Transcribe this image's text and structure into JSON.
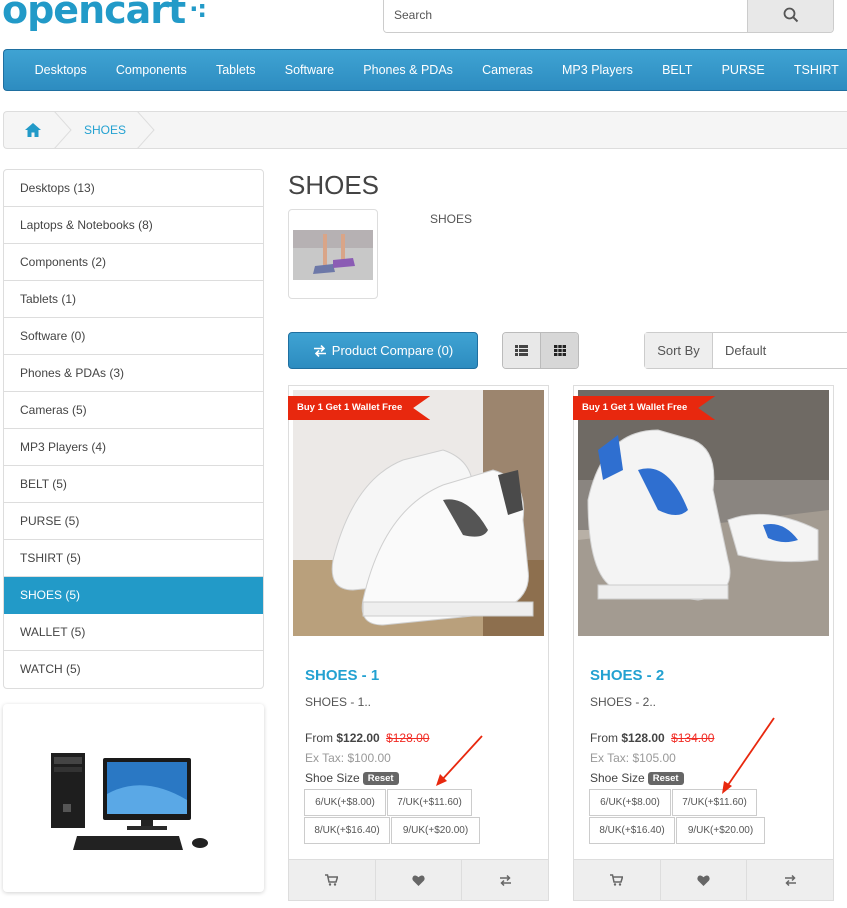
{
  "header": {
    "logo_text": "opencart",
    "search_placeholder": "Search"
  },
  "menu": [
    "Desktops",
    "Components",
    "Tablets",
    "Software",
    "Phones & PDAs",
    "Cameras",
    "MP3 Players",
    "BELT",
    "PURSE",
    "TSHIRT"
  ],
  "breadcrumb": {
    "current": "SHOES"
  },
  "categories": [
    {
      "label": "Desktops (13)",
      "active": false
    },
    {
      "label": "Laptops & Notebooks (8)",
      "active": false
    },
    {
      "label": "Components (2)",
      "active": false
    },
    {
      "label": "Tablets (1)",
      "active": false
    },
    {
      "label": "Software (0)",
      "active": false
    },
    {
      "label": "Phones & PDAs (3)",
      "active": false
    },
    {
      "label": "Cameras (5)",
      "active": false
    },
    {
      "label": "MP3 Players (4)",
      "active": false
    },
    {
      "label": "BELT (5)",
      "active": false
    },
    {
      "label": "PURSE (5)",
      "active": false
    },
    {
      "label": "TSHIRT (5)",
      "active": false
    },
    {
      "label": "SHOES (5)",
      "active": true
    },
    {
      "label": "WALLET (5)",
      "active": false
    },
    {
      "label": "WATCH (5)",
      "active": false
    }
  ],
  "page": {
    "title": "SHOES",
    "description": "SHOES"
  },
  "toolbar": {
    "compare_label": "Product Compare (0)",
    "sort_label": "Sort By",
    "sort_value": "Default"
  },
  "products": [
    {
      "ribbon": "Buy 1 Get 1 Wallet Free",
      "name": "SHOES - 1",
      "desc": "SHOES - 1..",
      "price_prefix": "From",
      "price": "$122.00",
      "old_price": "$128.00",
      "ex_tax": "Ex Tax: $100.00",
      "size_label": "Shoe Size",
      "reset_label": "Reset",
      "options": [
        "6/UK(+$8.00)",
        "7/UK(+$11.60)",
        "8/UK(+$16.40)",
        "9/UK(+$20.00)"
      ],
      "accent": "#4a4a4a"
    },
    {
      "ribbon": "Buy 1 Get 1 Wallet Free",
      "name": "SHOES - 2",
      "desc": "SHOES - 2..",
      "price_prefix": "From",
      "price": "$128.00",
      "old_price": "$134.00",
      "ex_tax": "Ex Tax: $105.00",
      "size_label": "Shoe Size",
      "reset_label": "Reset",
      "options": [
        "6/UK(+$8.00)",
        "7/UK(+$11.60)",
        "8/UK(+$16.40)",
        "9/UK(+$20.00)"
      ],
      "accent": "#2f6fd0"
    }
  ],
  "colors": {
    "brand": "#229ac8",
    "sale": "#f12b24",
    "ribbon": "#e8280e"
  }
}
